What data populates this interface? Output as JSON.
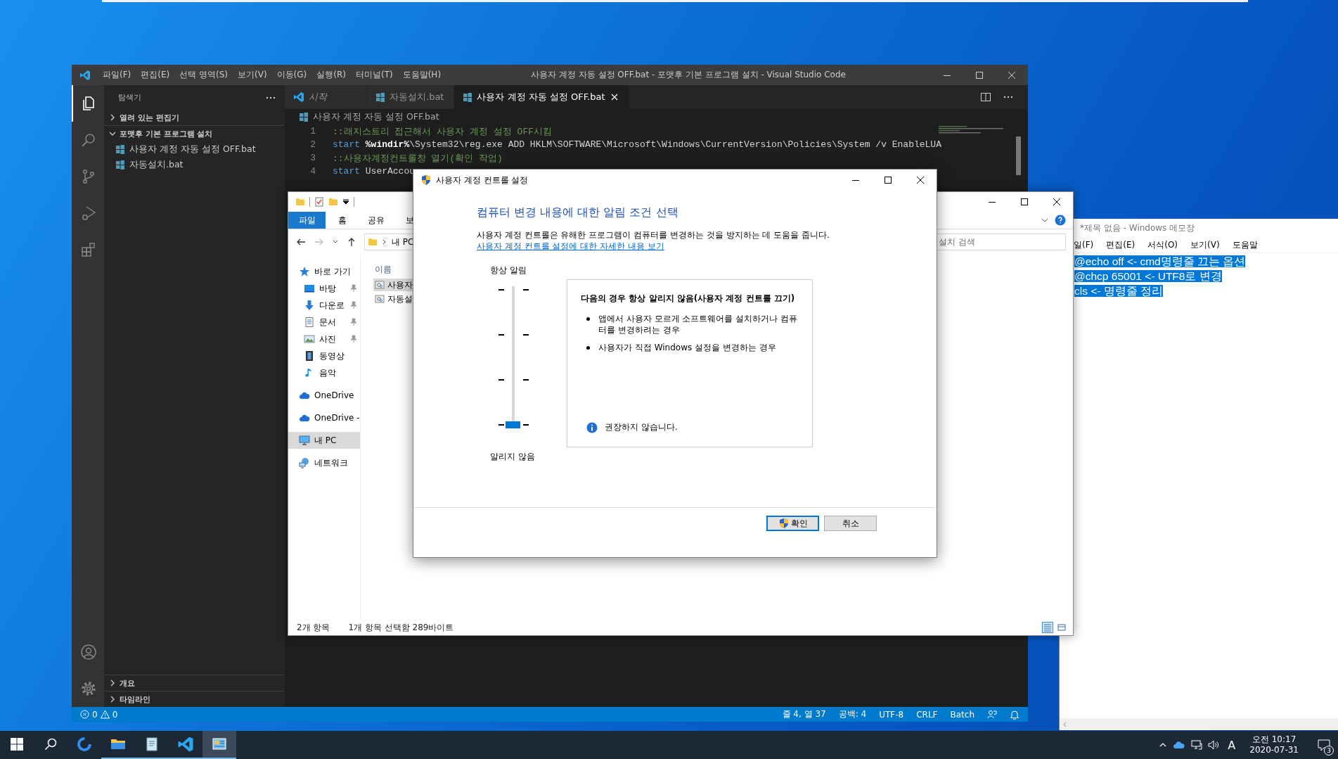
{
  "vscode": {
    "title": "사용자 계정 자동 설정 OFF.bat - 포맷후 기본 프로그램 설치 - Visual Studio Code",
    "menu": [
      "파일(F)",
      "편집(E)",
      "선택 영역(S)",
      "보기(V)",
      "이동(G)",
      "실행(R)",
      "터미널(T)",
      "도움말(H)"
    ],
    "activity": [
      {
        "kind": "explorer",
        "selected": true
      },
      {
        "kind": "search",
        "selected": false
      },
      {
        "kind": "scm",
        "selected": false
      },
      {
        "kind": "run",
        "selected": false
      },
      {
        "kind": "extensions",
        "selected": false
      }
    ],
    "activity_bottom": [
      {
        "kind": "account"
      },
      {
        "kind": "settings"
      }
    ],
    "sidebar": {
      "title": "탐색기",
      "sections": [
        {
          "label": "열려 있는 편집기",
          "expanded": false
        },
        {
          "label": "포맷후 기본 프로그램 설치",
          "expanded": true,
          "children": [
            {
              "label": "사용자 계정 자동 설정 OFF.bat"
            },
            {
              "label": "자동설치.bat"
            }
          ]
        }
      ],
      "bottom_sections": [
        {
          "label": "개요",
          "expanded": false
        },
        {
          "label": "타임라인",
          "expanded": false
        }
      ]
    },
    "tabs": [
      {
        "label": "시작",
        "kind": "welcome",
        "selected": false
      },
      {
        "label": "자동설치.bat",
        "kind": "file",
        "selected": false
      },
      {
        "label": "사용자 계정 자동 설정 OFF.bat",
        "kind": "file",
        "selected": true
      }
    ],
    "breadcrumb": "사용자 계정 자동 설정 OFF.bat",
    "code": [
      {
        "number": "1",
        "tokens": [
          {
            "kind": "comment",
            "text": "::래지스트리 접근해서 사용자 계정 설정 OFF시킴"
          }
        ]
      },
      {
        "number": "2",
        "tokens": [
          {
            "kind": "keyword",
            "text": "start"
          },
          {
            "kind": "variable",
            "text": " %windir%"
          },
          {
            "kind": "plain",
            "text": "\\System32\\reg.exe ADD HKLM\\SOFTWARE\\Microsoft\\Windows\\CurrentVersion\\Policies\\System /v EnableLUA"
          }
        ]
      },
      {
        "number": "3",
        "tokens": [
          {
            "kind": "comment",
            "text": "::사용자계정컨트롤창 열기(확인 작업)"
          }
        ]
      },
      {
        "number": "4",
        "tokens": [
          {
            "kind": "keyword",
            "text": "start"
          },
          {
            "kind": "plain",
            "text": " UserAccou"
          }
        ]
      }
    ],
    "status_bar": {
      "errors": "0",
      "warnings": "0",
      "items": [
        "줄 4, 열 37",
        "공백: 4",
        "UTF-8",
        "CRLF",
        "Batch"
      ]
    }
  },
  "explorer": {
    "ribbon_tabs": [
      {
        "label": "파일",
        "selected": true
      },
      {
        "label": "홈",
        "selected": false
      },
      {
        "label": "공유",
        "selected": false
      },
      {
        "label": "보",
        "selected": false
      }
    ],
    "address": "내 PC",
    "search_placeholder": "설치 검색",
    "nav": [
      {
        "label": "바로 가기",
        "kind": "quick",
        "selected": false,
        "children": [
          {
            "label": "바탕",
            "kind": "desktop",
            "pinned": true
          },
          {
            "label": "다운로",
            "kind": "download",
            "pinned": true
          },
          {
            "label": "문서",
            "kind": "documents",
            "pinned": true
          },
          {
            "label": "사진",
            "kind": "pictures",
            "pinned": true
          },
          {
            "label": "동영상",
            "kind": "videos",
            "pinned": false
          },
          {
            "label": "음악",
            "kind": "music",
            "pinned": false
          }
        ]
      },
      {
        "label": "OneDrive",
        "kind": "cloud",
        "selected": false
      },
      {
        "label": "OneDrive -",
        "kind": "cloud",
        "selected": false
      },
      {
        "label": "내 PC",
        "kind": "pc",
        "selected": true
      },
      {
        "label": "네트워크",
        "kind": "network",
        "selected": false
      }
    ],
    "column_header": "이름",
    "files": [
      {
        "label": "사용자",
        "selected": true
      },
      {
        "label": "자동설",
        "selected": false
      }
    ],
    "status": [
      "2개 항목",
      "1개 항목 선택함 289바이트"
    ],
    "views": [
      {
        "kind": "details",
        "selected": true
      },
      {
        "kind": "tiles",
        "selected": false
      }
    ]
  },
  "dialog": {
    "title": "사용자 계정 컨트롤 설정",
    "heading": "컴퓨터 변경 내용에 대한 알림 조건 선택",
    "description": "사용자 계정 컨트롤은 유해한 프로그램이 컴퓨터를 변경하는 것을 방지하는 데 도움을 줍니다.",
    "link": "사용자 계정 컨트롤 설정에 대한 자세한 내용 보기",
    "top_label": "항상 알림",
    "bottom_label": "알리지 않음",
    "slider": {
      "level": 0
    },
    "panel": {
      "title": "다음의 경우 항상 알리지 않음(사용자 계정 컨트롤 끄기)",
      "bullets": [
        "앱에서 사용자 모르게 소프트웨어를 설치하거나 컴퓨터를 변경하려는 경우",
        "사용자가 직접 Windows 설정을 변경하는 경우"
      ],
      "note": "권장하지 않습니다."
    },
    "buttons": [
      {
        "label": "확인",
        "kind": "elevated",
        "default": true
      },
      {
        "label": "취소",
        "kind": "plain",
        "default": false
      }
    ]
  },
  "notepad": {
    "title": "*제목 없음 - Windows 메모장",
    "menu": [
      "일(F)",
      "편집(E)",
      "서식(O)",
      "보기(V)",
      "도움말"
    ],
    "lines": [
      "@echo off <- cmd명령줄 끄는 옵션",
      "@chcp 65001 <- UTF8로 변경",
      "cls <- 명령줄 정리"
    ],
    "selected": true
  },
  "taskbar": {
    "apps": [
      {
        "kind": "browser",
        "running": false,
        "selected": false
      },
      {
        "kind": "files",
        "running": true,
        "selected": false
      },
      {
        "kind": "notepad",
        "running": true,
        "selected": false
      },
      {
        "kind": "vscode",
        "running": true,
        "selected": false
      },
      {
        "kind": "control",
        "running": true,
        "selected": true
      }
    ],
    "input_indicator": "A",
    "time": "오전 10:17",
    "date": "2020-07-31",
    "notifications": "3"
  }
}
